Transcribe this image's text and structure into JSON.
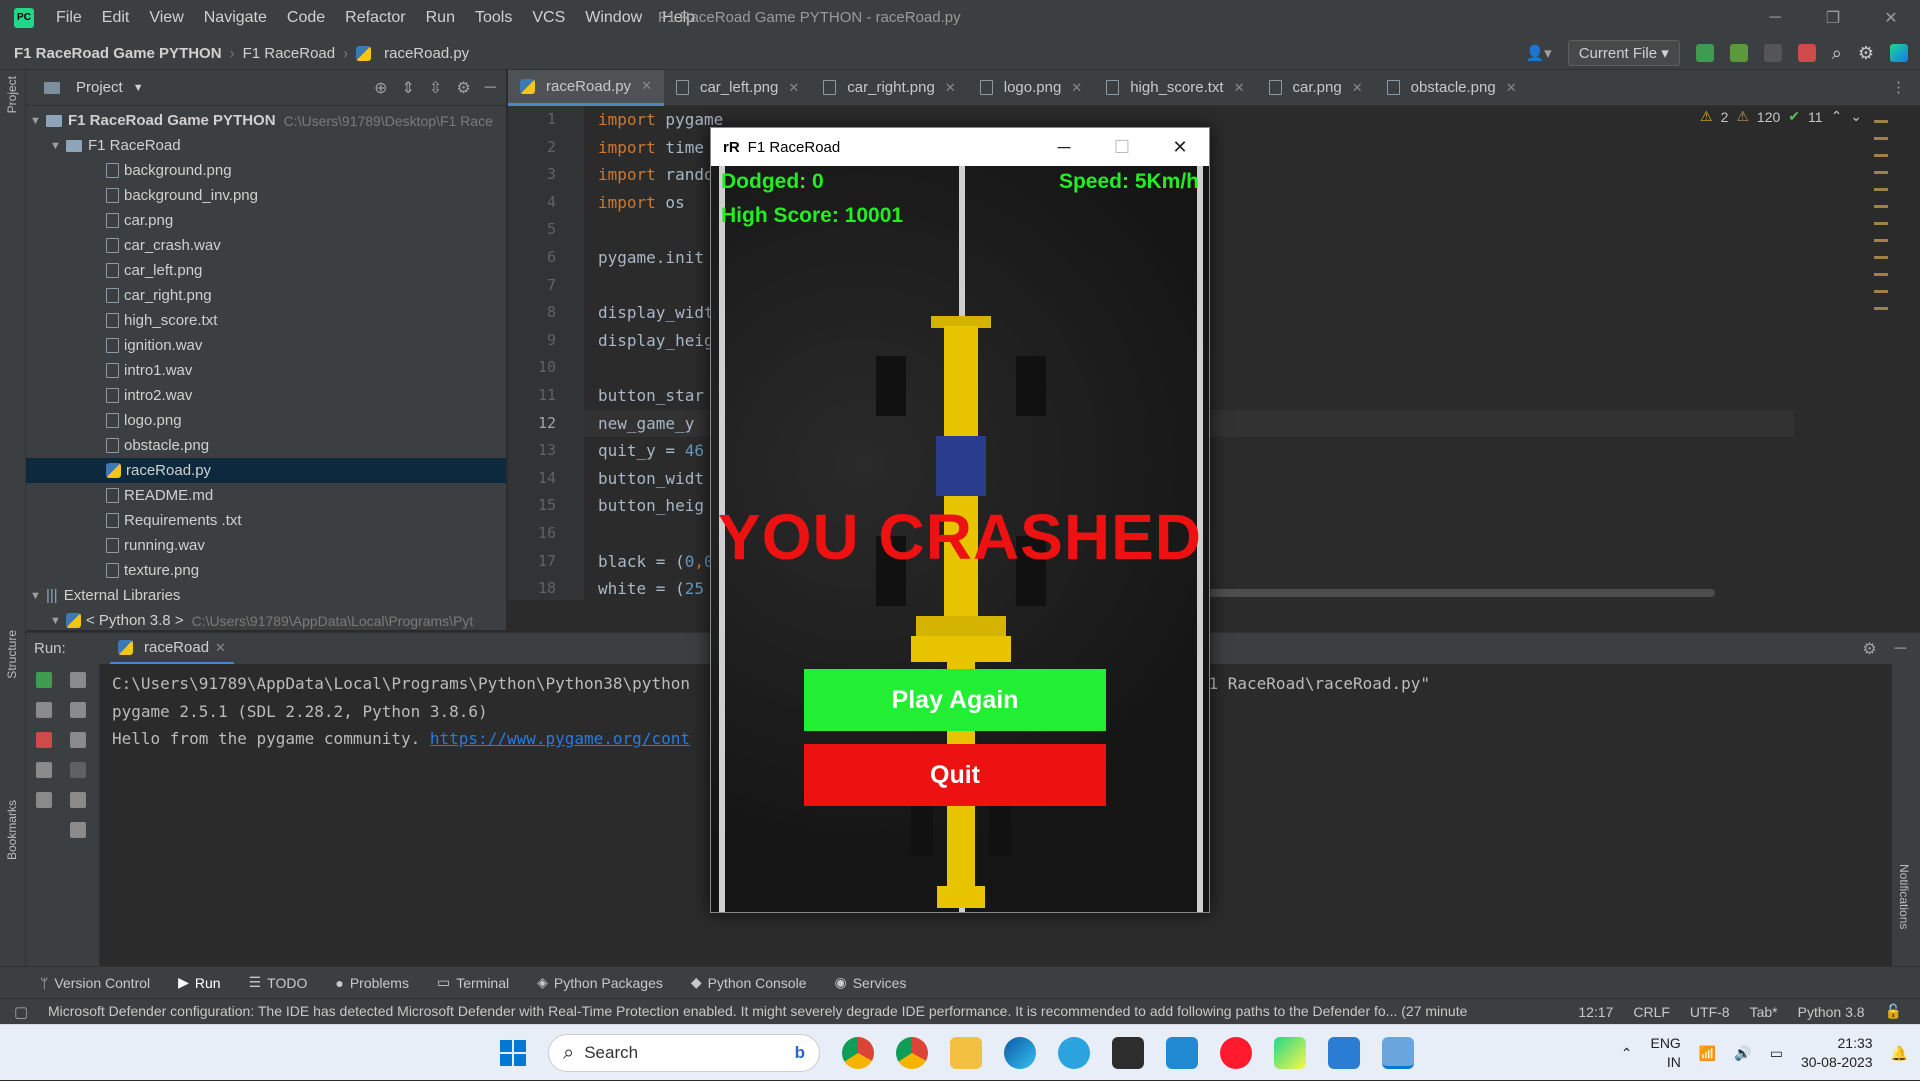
{
  "window_title": "F1 RaceRoad Game PYTHON - raceRoad.py",
  "menu": [
    "File",
    "Edit",
    "View",
    "Navigate",
    "Code",
    "Refactor",
    "Run",
    "Tools",
    "VCS",
    "Window",
    "Help"
  ],
  "breadcrumbs": [
    "F1 RaceRoad Game PYTHON",
    "F1 RaceRoad",
    "raceRoad.py"
  ],
  "run_config": "Current File",
  "project_panel": {
    "title": "Project",
    "root": {
      "name": "F1 RaceRoad Game PYTHON",
      "path": "C:\\Users\\91789\\Desktop\\F1 Race"
    },
    "folder": "F1 RaceRoad",
    "files": [
      "background.png",
      "background_inv.png",
      "car.png",
      "car_crash.wav",
      "car_left.png",
      "car_right.png",
      "high_score.txt",
      "ignition.wav",
      "intro1.wav",
      "intro2.wav",
      "logo.png",
      "obstacle.png",
      "raceRoad.py",
      "README.md",
      "Requirements .txt",
      "running.wav",
      "texture.png"
    ],
    "selected_file": "raceRoad.py",
    "external_libraries": "External Libraries",
    "python_sdk": {
      "name": "< Python 3.8 >",
      "path": "C:\\Users\\91789\\AppData\\Local\\Programs\\Pyt"
    }
  },
  "editor_tabs": [
    "raceRoad.py",
    "car_left.png",
    "car_right.png",
    "logo.png",
    "high_score.txt",
    "car.png",
    "obstacle.png"
  ],
  "active_tab": "raceRoad.py",
  "inspections": {
    "warnings": "2",
    "weak_warnings": "120",
    "ok": "11"
  },
  "line_numbers": [
    "1",
    "2",
    "3",
    "4",
    "5",
    "6",
    "7",
    "8",
    "9",
    "10",
    "11",
    "12",
    "13",
    "14",
    "15",
    "16",
    "17",
    "18"
  ],
  "current_line": "12",
  "code": {
    "l1": [
      "import",
      " pygame"
    ],
    "l2": [
      "import",
      " time"
    ],
    "l3": [
      "import",
      " rando"
    ],
    "l4": [
      "import",
      " os"
    ],
    "l6": "pygame.init",
    "l8": "display_widt",
    "l9": "display_heig",
    "l11": "button_star",
    "l12": "new_game_y ",
    "l13": [
      "quit_y = ",
      "46"
    ],
    "l14": "button_widt",
    "l15": "button_heig",
    "l17": [
      "black = (",
      "0",
      ",",
      "0"
    ],
    "l18": [
      "white = (",
      "25"
    ]
  },
  "run_panel": {
    "label": "Run:",
    "tab": "raceRoad",
    "console": {
      "line1_a": "C:\\Users\\91789\\AppData\\Local\\Programs\\Python\\Python38\\python",
      "line1_b": "ON\\F1 RaceRoad\\raceRoad.py\"",
      "line2": "pygame 2.5.1 (SDL 2.28.2, Python 3.8.6)",
      "line3": "Hello from the pygame community. ",
      "line3_link": "https://www.pygame.org/cont"
    }
  },
  "side_labels": {
    "project": "Project",
    "structure": "Structure",
    "bookmarks": "Bookmarks",
    "notifications": "Notifications"
  },
  "tool_tabs": [
    "Version Control",
    "Run",
    "TODO",
    "Problems",
    "Terminal",
    "Python Packages",
    "Python Console",
    "Services"
  ],
  "active_tool_tab": "Run",
  "status": {
    "message": "Microsoft Defender configuration: The IDE has detected Microsoft Defender with Real-Time Protection enabled. It might severely degrade IDE performance. It is recommended to add following paths to the Defender fo... (27 minute",
    "position": "12:17",
    "line_sep": "CRLF",
    "encoding": "UTF-8",
    "indent": "Tab*",
    "interpreter": "Python 3.8"
  },
  "game": {
    "window_title": "F1 RaceRoad",
    "icon_text": "rR",
    "dodged": "Dodged: 0",
    "speed": "Speed: 5Km/h",
    "high_score": "High Score: 10001",
    "crash_text": "YOU CRASHED",
    "play_again": "Play Again",
    "quit": "Quit",
    "colors": {
      "hud": "#22ee22",
      "crash": "#ee1111",
      "play": "#22ee33",
      "quit": "#ee1111"
    }
  },
  "taskbar": {
    "search_placeholder": "Search",
    "lang_line1": "ENG",
    "lang_line2": "IN",
    "time": "21:33",
    "date": "30-08-2023"
  }
}
